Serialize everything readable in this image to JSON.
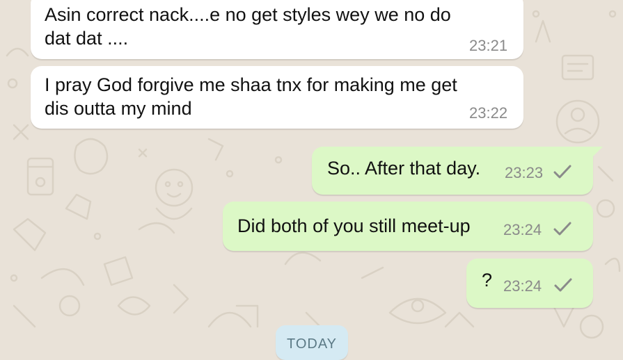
{
  "messages": [
    {
      "direction": "incoming",
      "text": "Asin correct nack....e no get styles wey we no do\ndat dat ....",
      "time": "23:21"
    },
    {
      "direction": "incoming",
      "text": "I pray God forgive me shaa tnx for making me get\ndis outta my mind",
      "time": "23:22"
    },
    {
      "direction": "outgoing",
      "text": "So.. After that day.",
      "time": "23:23",
      "status_icon": "single-check-icon"
    },
    {
      "direction": "outgoing",
      "text": "Did both of you still meet-up",
      "time": "23:24",
      "status_icon": "single-check-icon"
    },
    {
      "direction": "outgoing",
      "text": "?",
      "time": "23:24",
      "status_icon": "single-check-icon"
    }
  ],
  "date_divider": {
    "label": "TODAY"
  },
  "colors": {
    "wallpaper": "#e9e2d8",
    "incoming_bubble": "#ffffff",
    "outgoing_bubble": "#dcf8c6",
    "timestamp": "#8a8a8a",
    "check": "#8a8a8a",
    "date_chip": "#d5eaf3"
  }
}
